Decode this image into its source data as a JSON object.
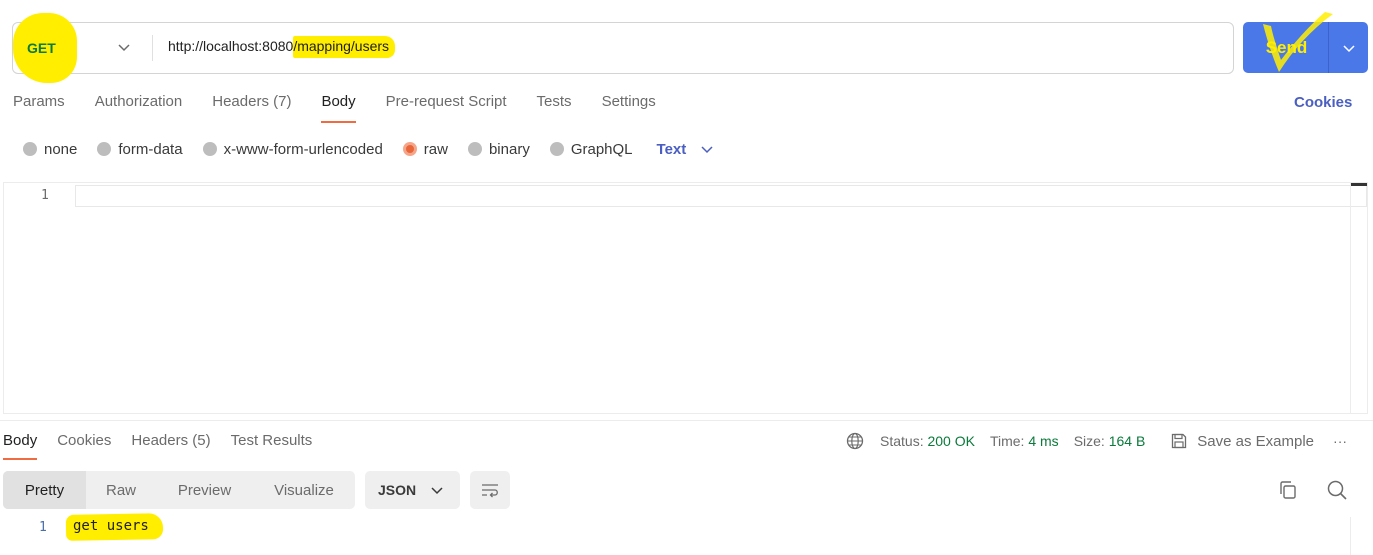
{
  "request": {
    "method": "GET",
    "url_base": "http://localhost:8080",
    "url_path": "/mapping/users",
    "send_label": "Send"
  },
  "request_tabs": [
    {
      "label": "Params"
    },
    {
      "label": "Authorization"
    },
    {
      "label": "Headers (7)"
    },
    {
      "label": "Body",
      "active": true
    },
    {
      "label": "Pre-request Script"
    },
    {
      "label": "Tests"
    },
    {
      "label": "Settings"
    }
  ],
  "cookies_link": "Cookies",
  "body_types": [
    {
      "label": "none"
    },
    {
      "label": "form-data"
    },
    {
      "label": "x-www-form-urlencoded"
    },
    {
      "label": "raw",
      "selected": true
    },
    {
      "label": "binary"
    },
    {
      "label": "GraphQL"
    }
  ],
  "raw_format": "Text",
  "editor": {
    "line_number": "1",
    "content": ""
  },
  "response_tabs": [
    {
      "label": "Body",
      "active": true
    },
    {
      "label": "Cookies"
    },
    {
      "label": "Headers (5)"
    },
    {
      "label": "Test Results"
    }
  ],
  "response_meta": {
    "status_label": "Status:",
    "status_value": "200 OK",
    "time_label": "Time:",
    "time_value": "4 ms",
    "size_label": "Size:",
    "size_value": "164 B",
    "save_label": "Save as Example",
    "more_label": "···"
  },
  "view_modes": [
    {
      "label": "Pretty",
      "active": true
    },
    {
      "label": "Raw"
    },
    {
      "label": "Preview"
    },
    {
      "label": "Visualize"
    }
  ],
  "response_format": "JSON",
  "response_body": {
    "line_number": "1",
    "content": "get users"
  },
  "colors": {
    "accent": "#ef6c42",
    "send_button": "#4a78e8",
    "link": "#4a5fc1",
    "method_get": "#0b7a3b",
    "highlight": "#ffee00"
  },
  "icons": {
    "method_dropdown": "chevron-down-icon",
    "send_dropdown": "chevron-down-icon",
    "network": "globe-icon",
    "save": "save-icon",
    "wrap": "wrap-lines-icon",
    "copy": "copy-icon",
    "search": "search-icon"
  }
}
